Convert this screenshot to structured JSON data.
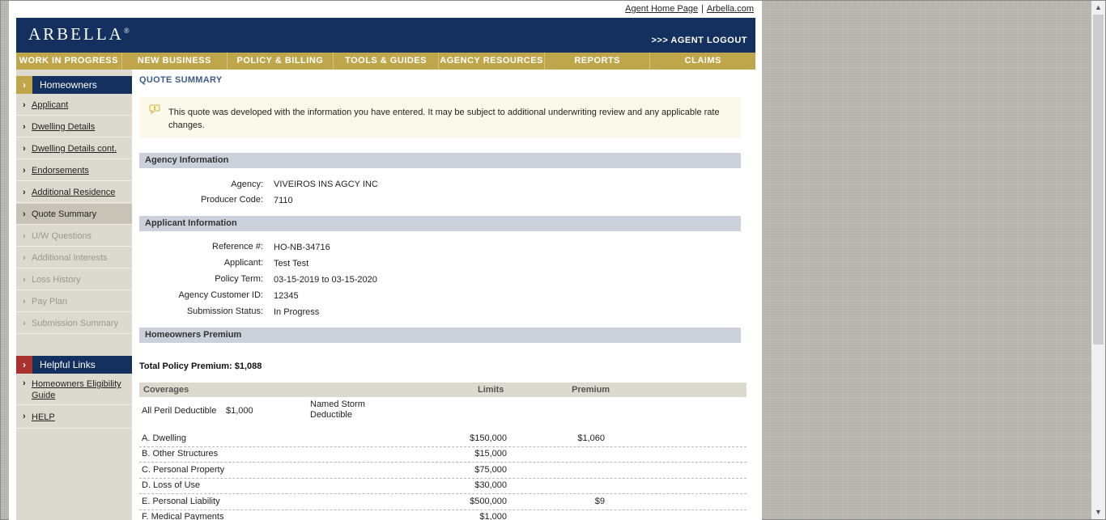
{
  "toplinks": {
    "agent_home": "Agent Home Page",
    "separator": "|",
    "arbella_com": "Arbella.com"
  },
  "header": {
    "logo": "ARBELLA",
    "logo_mark": "®",
    "logout": ">>> AGENT LOGOUT"
  },
  "nav": [
    "WORK IN PROGRESS",
    "NEW BUSINESS",
    "POLICY & BILLING",
    "TOOLS & GUIDES",
    "AGENCY RESOURCES",
    "REPORTS",
    "CLAIMS"
  ],
  "sidebar": {
    "section_title": "Homeowners",
    "items": [
      {
        "label": "Applicant",
        "state": "link"
      },
      {
        "label": "Dwelling Details",
        "state": "link"
      },
      {
        "label": "Dwelling Details cont.",
        "state": "link"
      },
      {
        "label": "Endorsements",
        "state": "link"
      },
      {
        "label": "Additional Residence",
        "state": "link"
      },
      {
        "label": "Quote Summary",
        "state": "active"
      },
      {
        "label": "U/W Questions",
        "state": "disabled"
      },
      {
        "label": "Additional Interests",
        "state": "disabled"
      },
      {
        "label": "Loss History",
        "state": "disabled"
      },
      {
        "label": "Pay Plan",
        "state": "disabled"
      },
      {
        "label": "Submission Summary",
        "state": "disabled"
      }
    ],
    "helpful_title": "Helpful Links",
    "help_links": [
      "Homeowners Eligibility Guide",
      "HELP"
    ],
    "chevron": "›"
  },
  "main": {
    "title": "QUOTE SUMMARY",
    "notice": "This quote was developed with the information you have entered. It may be subject to additional underwriting review and any applicable rate changes.",
    "agency_section": "Agency Information",
    "agency_label": "Agency:",
    "agency_value": "VIVEIROS INS AGCY INC",
    "producer_label": "Producer Code:",
    "producer_value": "7110",
    "applicant_section": "Applicant Information",
    "applicant_fields": [
      {
        "label": "Reference #:",
        "value": "HO-NB-34716"
      },
      {
        "label": "Applicant:",
        "value": "Test Test"
      },
      {
        "label": "Policy Term:",
        "value": "03-15-2019 to 03-15-2020"
      },
      {
        "label": "Agency Customer ID:",
        "value": "12345"
      },
      {
        "label": "Submission Status:",
        "value": "In Progress"
      }
    ],
    "premium_section": "Homeowners Premium",
    "total_premium": "Total Policy Premium: $1,088",
    "coverage_headers": {
      "coverages": "Coverages",
      "limits": "Limits",
      "premium": "Premium"
    },
    "deductible": {
      "label": "All Peril Deductible",
      "value": "$1,000",
      "storm_label_1": "Named Storm",
      "storm_label_2": "Deductible"
    },
    "coverages": [
      {
        "name": "A. Dwelling",
        "limit": "$150,000",
        "premium": "$1,060"
      },
      {
        "name": "B. Other Structures",
        "limit": "$15,000",
        "premium": ""
      },
      {
        "name": "C. Personal Property",
        "limit": "$75,000",
        "premium": ""
      },
      {
        "name": "D. Loss of Use",
        "limit": "$30,000",
        "premium": ""
      },
      {
        "name": "E. Personal Liability",
        "limit": "$500,000",
        "premium": "$9"
      },
      {
        "name": "F. Medical Payments",
        "limit": "$1,000",
        "premium": ""
      }
    ]
  },
  "scrollbar": {
    "up": "▲",
    "down": "▼"
  }
}
